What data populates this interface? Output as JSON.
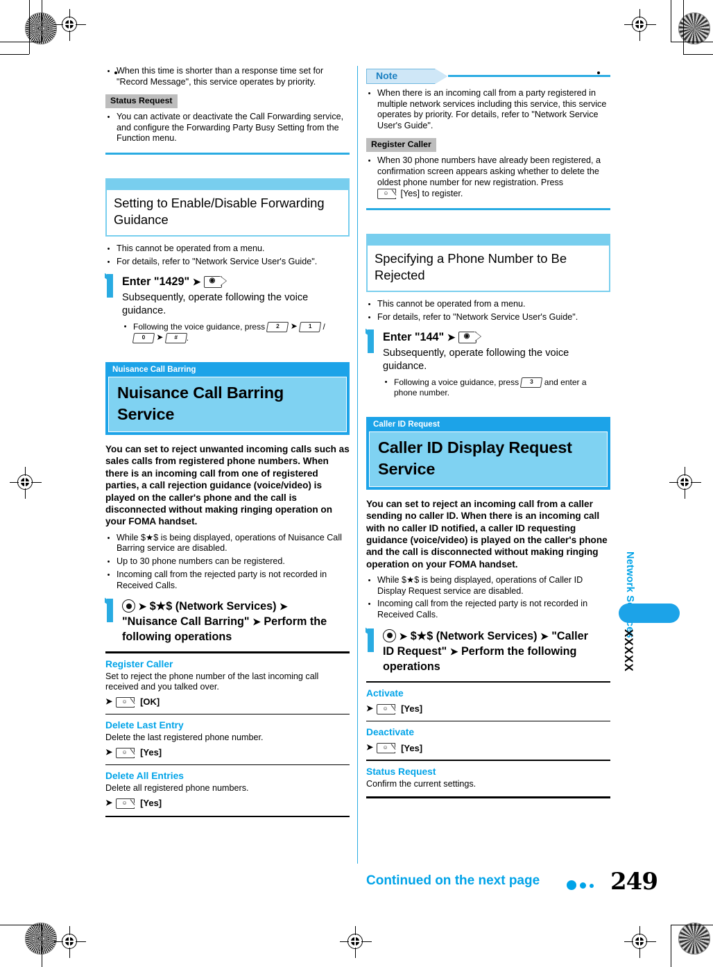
{
  "page": {
    "number": "249",
    "continued_label": "Continued on the next page",
    "side_tab_label": "Network Services",
    "side_tab_marker": "XXXXX"
  },
  "colors": {
    "accent_blue": "#00A3E8",
    "header_blue": "#1CA3E8",
    "light_blue": "#7FD2F2",
    "band_blue": "#78CEEE",
    "rule_blue": "#29ABE2",
    "gray_badge": "#BDBDBD"
  },
  "left_column": {
    "top_bullets": [
      "When this time is shorter than a response time set for \"Record Message\", this service operates by priority."
    ],
    "status_request_badge": "Status Request",
    "status_request_bullets": [
      "You can activate or deactivate the Call Forwarding service, and configure the Forwarding Party Busy Setting from the Function menu."
    ],
    "section_forwarding_guidance": {
      "title": "Setting to Enable/Disable Forwarding Guidance",
      "notes": [
        "This cannot be operated from a menu.",
        "For details, refer to \"Network Service User's Guide\"."
      ],
      "step": {
        "number": "1",
        "heading_text": "Enter \"1429\"",
        "key_call": "call-key",
        "description": "Subsequently, operate following the voice guidance.",
        "sub_note_prefix": "Following the voice guidance, press",
        "key_2": "2",
        "key_1": "1",
        "separator": "/",
        "key_0": "0",
        "key_hash": "#",
        "sub_note_suffix": "."
      }
    },
    "service_nuisance": {
      "tag": "Nuisance Call Barring",
      "title": "Nuisance Call Barring Service",
      "lead": "You can set to reject unwanted incoming calls such as sales calls from registered phone numbers. When there is an incoming call from one of registered parties, a call rejection guidance (voice/video) is played on the caller's phone and the call is disconnected without making ringing operation on your FOMA handset.",
      "bullets": [
        "While $★$ is being displayed, operations of Nuisance Call Barring service are disabled.",
        "Up to 30 phone numbers can be registered.",
        "Incoming call from the rejected party is not recorded in Received Calls."
      ],
      "step": {
        "number": "1",
        "line1_after_select": "$★$ (Network Services)",
        "line2": "\"Nuisance Call Barring\"",
        "line3": "Perform the following operations"
      },
      "operations": [
        {
          "name": "Register Caller",
          "desc": "Set to reject the phone number of the last incoming call received and you talked over.",
          "key": "fn-key",
          "action": "[OK]"
        },
        {
          "name": "Delete Last Entry",
          "desc": "Delete the last registered phone number.",
          "key": "fn-key",
          "action": "[Yes]"
        },
        {
          "name": "Delete All Entries",
          "desc": "Delete all registered phone numbers.",
          "key": "fn-key",
          "action": "[Yes]"
        }
      ]
    }
  },
  "right_column": {
    "note": {
      "label": "Note",
      "bullets": [
        "When there is an incoming call from a party registered in multiple network services including this service, this service operates by priority. For details, refer to \"Network Service User's Guide\"."
      ],
      "register_caller_badge": "Register Caller",
      "register_caller_bullet_prefix": "When 30 phone numbers have already been registered, a confirmation screen appears asking whether to delete the oldest phone number for new registration. Press",
      "register_caller_key": "fn-key",
      "register_caller_bullet_suffix": "[Yes]  to register."
    },
    "section_specify_number": {
      "title": "Specifying a Phone Number to Be Rejected",
      "notes": [
        "This cannot be operated from a menu.",
        "For details, refer to \"Network Service User's Guide\"."
      ],
      "step": {
        "number": "1",
        "heading_text": "Enter \"144\"",
        "key_call": "call-key",
        "description": "Subsequently, operate following the voice guidance.",
        "sub_note_prefix": "Following a voice guidance, press",
        "key_3": "3",
        "sub_note_suffix": "and enter a phone number."
      }
    },
    "service_caller_id": {
      "tag": "Caller ID Request",
      "title": "Caller ID Display Request Service",
      "lead": "You can set to reject an incoming call from a caller sending no caller ID. When there is an incoming call with no caller ID notified, a caller ID requesting guidance (voice/video) is played on the caller's phone and the call is disconnected without making ringing operation on your FOMA handset.",
      "bullets": [
        "While $★$ is being displayed, operations of Caller ID Display Request service are disabled.",
        "Incoming call from the rejected party is not recorded in Received Calls."
      ],
      "step": {
        "number": "1",
        "line1_after_select": "$★$ (Network Services)",
        "line1_tail": "\"Caller",
        "line2": "ID Request\"",
        "line3": "Perform the following",
        "line4": "operations"
      },
      "operations": [
        {
          "name": "Activate",
          "desc": "",
          "key": "fn-key",
          "action": "[Yes]"
        },
        {
          "name": "Deactivate",
          "desc": "",
          "key": "fn-key",
          "action": "[Yes]"
        },
        {
          "name": "Status Request",
          "desc": "Confirm the current settings.",
          "key": "",
          "action": ""
        }
      ]
    }
  }
}
